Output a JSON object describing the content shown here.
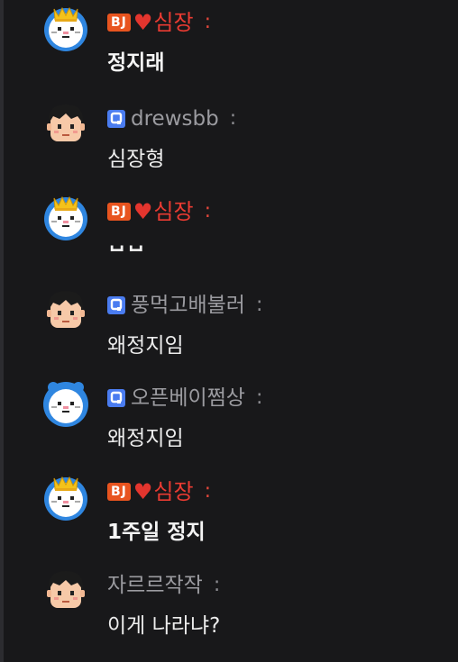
{
  "colors": {
    "background": "#18181a",
    "bj_badge": "#e8541f",
    "bj_name": "#ea3b32",
    "fan_badge": "#4a7cf0",
    "user_name": "#9b9ba0",
    "message_text": "#ececec"
  },
  "messages": [
    {
      "avatar_icon": "crowned-white-cat-avatar-icon",
      "badge": "BJ",
      "heart": "♥",
      "nickname": "심장",
      "colon": ":",
      "text": "정지래"
    },
    {
      "avatar_icon": "boy-avatar-icon",
      "fan_badge_icon": "fan-badge-icon",
      "nickname": "drewsbb",
      "colon": ":",
      "text": "심장형"
    },
    {
      "avatar_icon": "crowned-white-cat-avatar-icon",
      "badge": "BJ",
      "heart": "♥",
      "nickname": "심장",
      "colon": ":",
      "text": "ㅂㅂ"
    },
    {
      "avatar_icon": "boy-avatar-icon",
      "fan_badge_icon": "fan-badge-icon",
      "nickname": "풍먹고배불러",
      "colon": ":",
      "text": "왜정지임"
    },
    {
      "avatar_icon": "blue-white-cat-avatar-icon",
      "fan_badge_icon": "fan-badge-icon",
      "nickname": "오픈베이쩜상",
      "colon": ":",
      "text": "왜정지임"
    },
    {
      "avatar_icon": "crowned-white-cat-avatar-icon",
      "badge": "BJ",
      "heart": "♥",
      "nickname": "심장",
      "colon": ":",
      "text": "1주일 정지"
    },
    {
      "avatar_icon": "boy-avatar-icon",
      "nickname": "자르르작작",
      "colon": ":",
      "text": "이게 나라냐?"
    }
  ]
}
